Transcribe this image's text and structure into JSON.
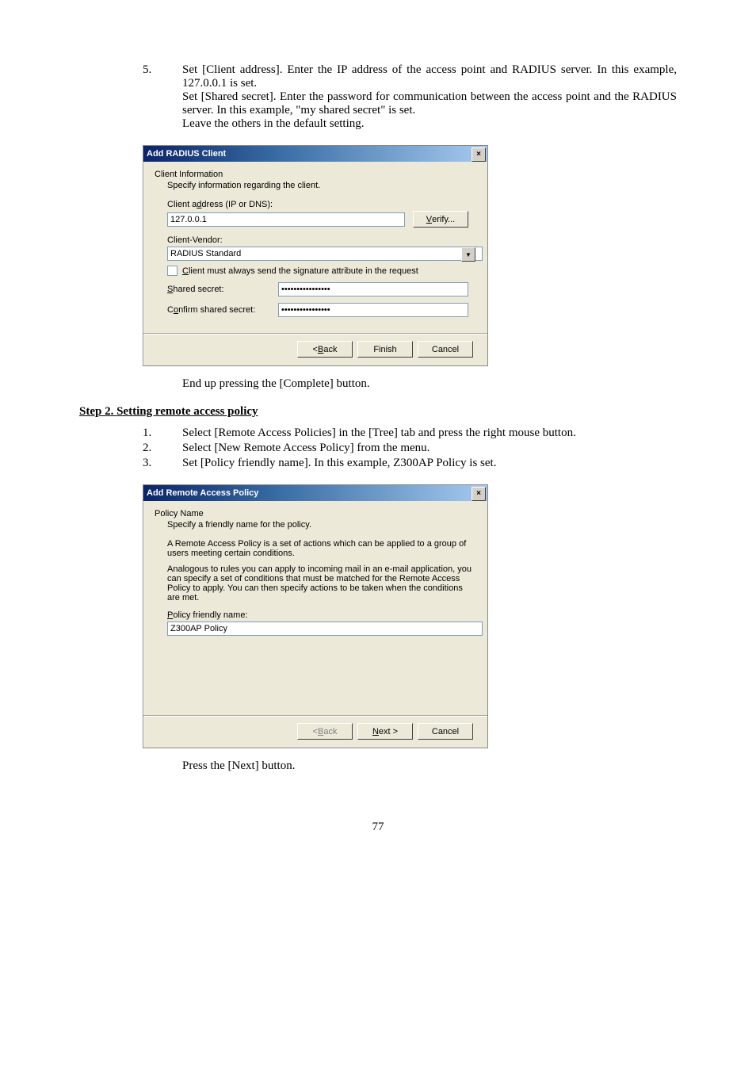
{
  "step5": {
    "num": "5.",
    "line1": "Set [Client address]. Enter the IP address of the access point and RADIUS server. In this example, 127.0.0.1 is set.",
    "line2": "Set [Shared secret]. Enter the password for communication between the access point and the RADIUS server. In this example, \"my shared secret\" is set.",
    "line3": "Leave the others in the default setting."
  },
  "dlg1": {
    "title": "Add RADIUS Client",
    "close": "×",
    "heading": "Client Information",
    "sub": "Specify information regarding the client.",
    "address_label_pre": "Client a",
    "address_label_u": "d",
    "address_label_post": "dress (IP or DNS):",
    "address_value": "127.0.0.1",
    "verify_u": "V",
    "verify_rest": "erify...",
    "vendor_label": "Client-Vendor:",
    "vendor_value": "RADIUS Standard",
    "checkbox_pre": "",
    "checkbox_u": "C",
    "checkbox_post": "lient must always send the signature attribute in the request",
    "shared_label_u": "S",
    "shared_label_rest": "hared secret:",
    "shared_value": "••••••••••••••••",
    "confirm_label_pre": "C",
    "confirm_label_u": "o",
    "confirm_label_post": "nfirm shared secret:",
    "confirm_value": "••••••••••••••••",
    "back_pre": "< ",
    "back_u": "B",
    "back_post": "ack",
    "finish": "Finish",
    "cancel": "Cancel"
  },
  "after_dlg1": "End up pressing the [Complete] button.",
  "step2_title": "Step 2.  Setting remote access policy",
  "s2items": {
    "n1": "1.",
    "t1": "Select [Remote Access Policies] in the [Tree] tab and press the right mouse button.",
    "n2": "2.",
    "t2": "Select [New Remote Access Policy] from the menu.",
    "n3": "3.",
    "t3": "Set [Policy friendly name].  In this example, Z300AP Policy is set."
  },
  "dlg2": {
    "title": "Add Remote Access Policy",
    "close": "×",
    "heading": "Policy Name",
    "sub": "Specify a friendly name for the policy.",
    "para1": "A Remote Access Policy is a set of actions which can be applied to a group of users meeting certain conditions.",
    "para2": "Analogous to rules you can apply to incoming mail in an e-mail application, you can specify a set of conditions that must be matched for the Remote Access Policy to apply. You can then specify actions to be taken when the conditions are met.",
    "name_label_u": "P",
    "name_label_rest": "olicy friendly name:",
    "name_value": "Z300AP Policy",
    "back_pre": "< ",
    "back_u": "B",
    "back_post": "ack",
    "next_u": "N",
    "next_rest": "ext >",
    "cancel": "Cancel"
  },
  "after_dlg2": "Press the [Next] button.",
  "pagenum": "77"
}
